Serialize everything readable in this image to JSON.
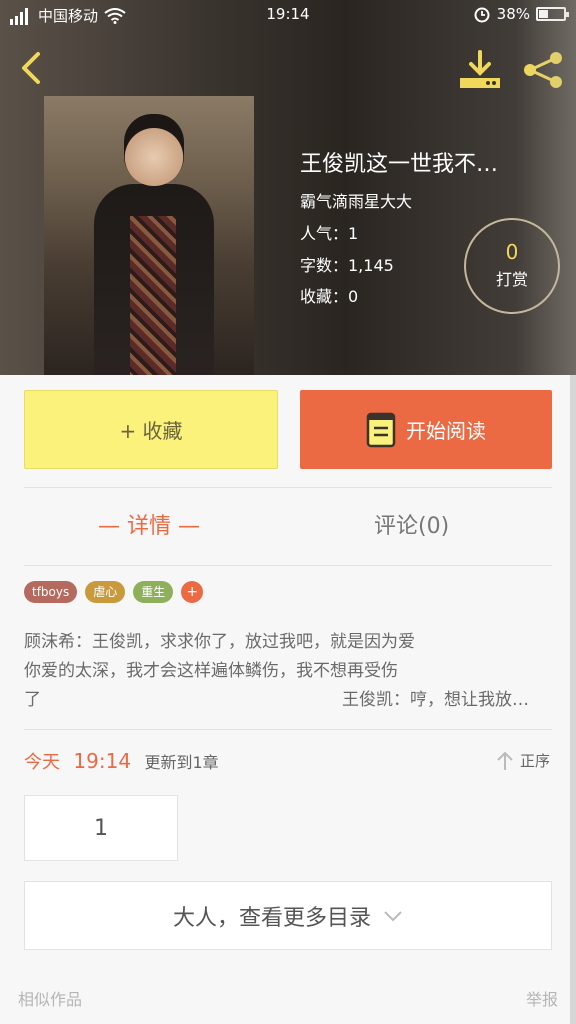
{
  "status_bar": {
    "carrier": "中国移动",
    "signal": "4G",
    "time": "19:14",
    "battery": "38%",
    "battery_level": 0.38
  },
  "book": {
    "title": "王俊凯这一世我不…",
    "author": "霸气滴雨星大大",
    "popularity": "人气：1",
    "word_count": "字数：1,145",
    "favorites": "收藏：0",
    "tip_count": "0",
    "tip_label": "打赏"
  },
  "actions": {
    "favorite_label": "+ 收藏",
    "read_label": "开始阅读"
  },
  "tabs": [
    {
      "label": "— 详情 —",
      "active": true
    },
    {
      "label": "评论(0)",
      "active": false
    }
  ],
  "tags": [
    {
      "label": "tfboys",
      "color": "#b46a5e"
    },
    {
      "label": "虐心",
      "color": "#c89a3c"
    },
    {
      "label": "重生",
      "color": "#8fb05a"
    }
  ],
  "tag_more": "+",
  "description": {
    "line1": "顾沫希：王俊凯，求求你了，放过我吧，就是因为爱",
    "line2": "你爱的太深，我才会这样遍体鳞伤，我不想再受伤",
    "line3": "了",
    "line3_right": "王俊凯：哼，想让我放…"
  },
  "update": {
    "day": "今天",
    "time": "19:14",
    "text": "更新到1章",
    "order_label": "正序"
  },
  "chapter_box": "1",
  "more_catalog_label": "大人，查看更多目录",
  "footer": {
    "similar": "相似作品",
    "report": "举报"
  },
  "colors": {
    "accent": "#ec6a43",
    "favorite_bg": "#fbf27b",
    "icon_yellow": "#f0d95a"
  }
}
